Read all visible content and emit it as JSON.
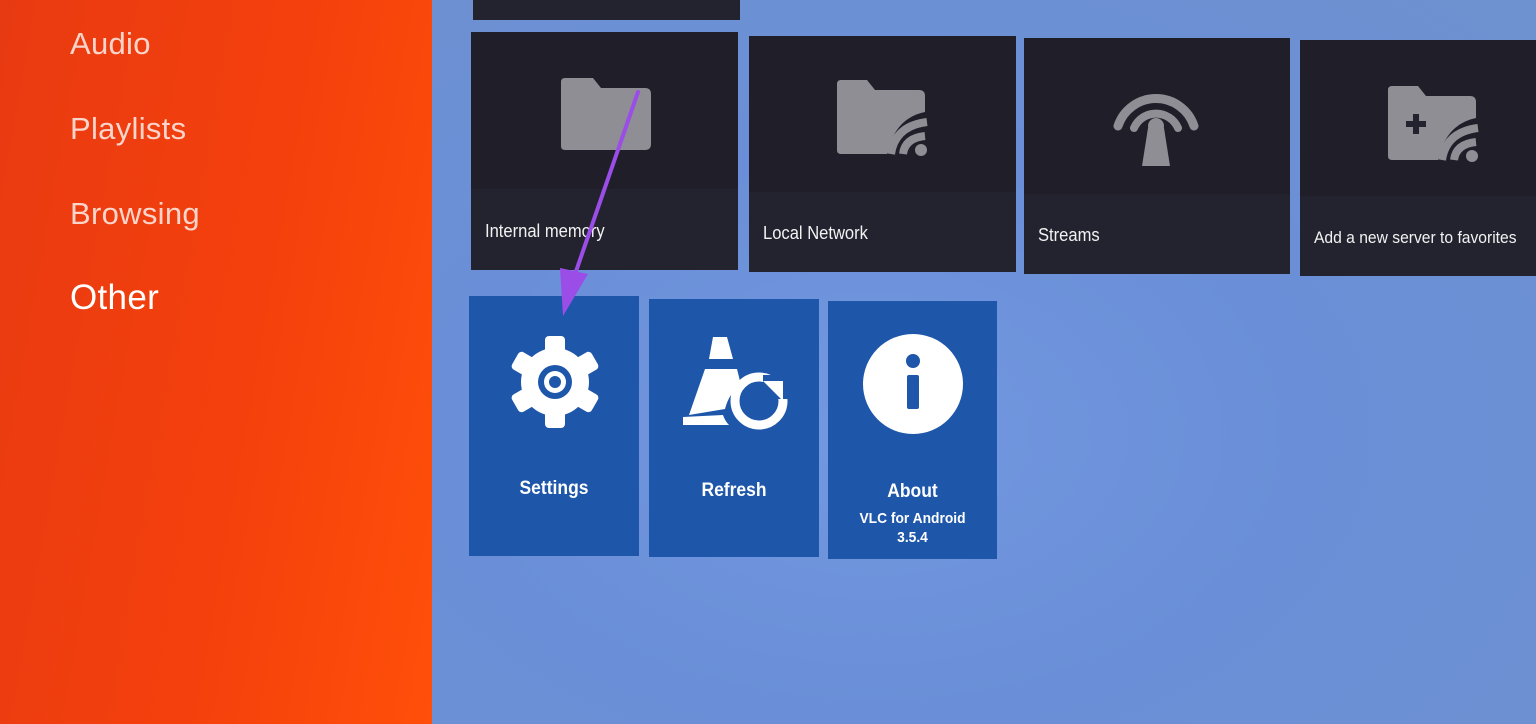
{
  "sidebar": {
    "items": [
      {
        "label": "Audio",
        "active": false
      },
      {
        "label": "Playlists",
        "active": false
      },
      {
        "label": "Browsing",
        "active": false
      },
      {
        "label": "Other",
        "active": true
      }
    ]
  },
  "browsing": {
    "tiles": [
      {
        "label": "Internal memory",
        "icon": "folder-icon"
      },
      {
        "label": "Local Network",
        "icon": "network-folder-icon"
      },
      {
        "label": "Streams",
        "icon": "stream-antenna-icon"
      },
      {
        "label": "Add a new server to favorites",
        "icon": "add-server-folder-icon"
      }
    ]
  },
  "other": {
    "tiles": [
      {
        "label": "Settings",
        "icon": "gear-icon"
      },
      {
        "label": "Refresh",
        "icon": "vlc-refresh-icon"
      },
      {
        "label": "About",
        "icon": "info-icon",
        "sub1": "VLC for Android",
        "sub2": "3.5.4"
      }
    ]
  },
  "colors": {
    "sidebar": "#f4400c",
    "background": "#6b90d6",
    "dark_tile": "#232330",
    "blue_tile": "#1e56aa",
    "annotation_arrow": "#9b4de8"
  }
}
